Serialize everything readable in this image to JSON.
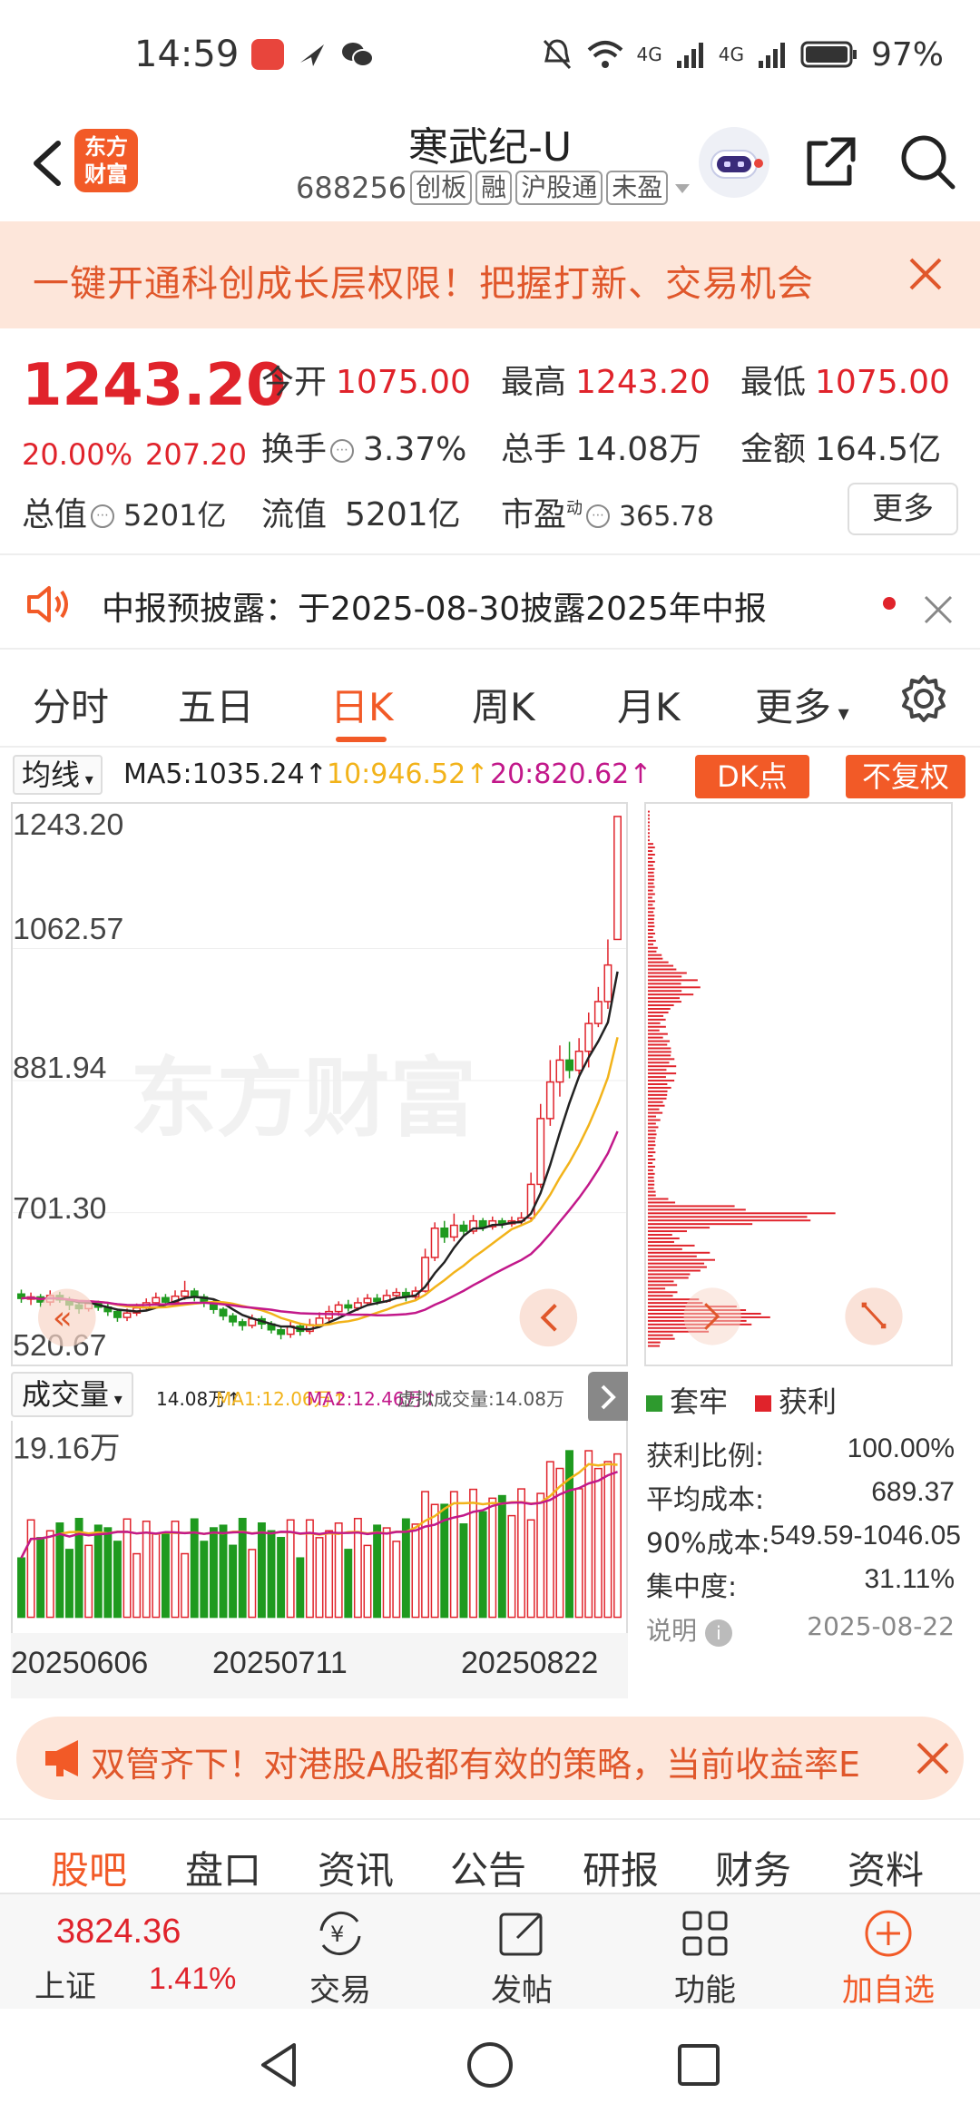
{
  "status": {
    "time": "14:59",
    "network1": "4G",
    "network2": "4G",
    "battery": "97%"
  },
  "header": {
    "logo_text": "东方财富",
    "title": "寒武纪-U",
    "code": "688256",
    "tags": [
      "创板",
      "融",
      "沪股通",
      "未盈"
    ]
  },
  "banner": {
    "text": "一键开通科创成长层权限！把握打新、交易机会"
  },
  "quote": {
    "price": "1243.20",
    "change_pct": "20.00%",
    "change_val": "207.20",
    "open_label": "今开",
    "open": "1075.00",
    "high_label": "最高",
    "high": "1243.20",
    "low_label": "最低",
    "low": "1075.00",
    "turnover_label": "换手",
    "turnover": "3.37%",
    "volume_label": "总手",
    "volume": "14.08万",
    "amount_label": "金额",
    "amount": "164.5亿",
    "mcap_label": "总值",
    "mcap": "5201亿",
    "float_label": "流值",
    "float_cap": "5201亿",
    "pe_label": "市盈",
    "pe_sup": "动",
    "pe": "365.78",
    "more": "更多"
  },
  "notice": {
    "text": "中报预披露：于2025-08-30披露2025年中报"
  },
  "ktabs": [
    "分时",
    "五日",
    "日K",
    "周K",
    "月K",
    "更多"
  ],
  "ma": {
    "select": "均线",
    "ma5": "MA5:1035.24↑",
    "ma10": "10:946.52↑",
    "ma20": "20:820.62↑",
    "btn_dk": "DK点",
    "btn_fq": "不复权",
    "ma5_color": "#222222",
    "ma10_color": "#f2b31a",
    "ma20_color": "#c2188a"
  },
  "kchart": {
    "ylabels": [
      "1243.20",
      "1062.57",
      "881.94",
      "701.30",
      "520.67"
    ],
    "watermark": "东方财富"
  },
  "volume": {
    "select": "成交量",
    "v": "14.08万↑",
    "ma1": "MA1:12.06万↑",
    "ma2": "MA2:12.46万↑",
    "virtual": "虚拟成交量:14.08万",
    "ymax": "19.16万"
  },
  "dates": [
    "20250606",
    "20250711",
    "20250822"
  ],
  "chips": {
    "legend_trapped": "套牢",
    "legend_profit": "获利",
    "rows": [
      {
        "label": "获利比例:",
        "value": "100.00%"
      },
      {
        "label": "平均成本:",
        "value": "689.37"
      },
      {
        "label": "90%成本:",
        "value": "549.59-1046.05"
      },
      {
        "label": "集中度:",
        "value": "31.11%"
      }
    ],
    "note": "说明",
    "date": "2025-08-22"
  },
  "ad": {
    "text": "双管齐下！对港股A股都有效的策略，当前收益率E"
  },
  "section_tabs": [
    "股吧",
    "盘口",
    "资讯",
    "公告",
    "研报",
    "财务",
    "资料"
  ],
  "bottom": {
    "index_value": "3824.36",
    "index_name": "上证",
    "index_pct": "1.41%",
    "trade": "交易",
    "post": "发帖",
    "func": "功能",
    "watch": "加自选"
  },
  "chart_data": {
    "type": "candlestick",
    "price_range": [
      520.67,
      1243.2
    ],
    "ylabels": [
      1243.2,
      1062.57,
      881.94,
      701.3,
      520.67
    ],
    "candles": [
      [
        590,
        584,
        596,
        578
      ],
      [
        583,
        586,
        592,
        575
      ],
      [
        586,
        579,
        590,
        572
      ],
      [
        579,
        588,
        595,
        574
      ],
      [
        588,
        582,
        593,
        578
      ],
      [
        582,
        575,
        586,
        568
      ],
      [
        575,
        570,
        580,
        563
      ],
      [
        570,
        577,
        582,
        566
      ],
      [
        577,
        572,
        581,
        567
      ],
      [
        572,
        566,
        577,
        560
      ],
      [
        566,
        558,
        570,
        552
      ],
      [
        558,
        564,
        570,
        553
      ],
      [
        564,
        571,
        577,
        560
      ],
      [
        571,
        578,
        584,
        568
      ],
      [
        578,
        585,
        592,
        574
      ],
      [
        585,
        579,
        590,
        574
      ],
      [
        579,
        587,
        595,
        575
      ],
      [
        587,
        594,
        608,
        582
      ],
      [
        594,
        586,
        598,
        580
      ],
      [
        586,
        578,
        590,
        572
      ],
      [
        578,
        569,
        582,
        563
      ],
      [
        569,
        560,
        572,
        554
      ],
      [
        560,
        552,
        564,
        546
      ],
      [
        552,
        547,
        556,
        540
      ],
      [
        547,
        556,
        562,
        543
      ],
      [
        556,
        549,
        560,
        542
      ],
      [
        549,
        541,
        553,
        536
      ],
      [
        541,
        535,
        546,
        528
      ],
      [
        535,
        546,
        552,
        530
      ],
      [
        546,
        539,
        550,
        533
      ],
      [
        539,
        548,
        556,
        535
      ],
      [
        548,
        557,
        565,
        545
      ],
      [
        557,
        566,
        574,
        552
      ],
      [
        566,
        575,
        580,
        560
      ],
      [
        575,
        571,
        582,
        566
      ],
      [
        571,
        578,
        585,
        567
      ],
      [
        578,
        584,
        590,
        574
      ],
      [
        584,
        580,
        590,
        575
      ],
      [
        580,
        588,
        596,
        578
      ],
      [
        588,
        592,
        598,
        584
      ],
      [
        592,
        586,
        598,
        580
      ],
      [
        586,
        594,
        600,
        582
      ],
      [
        594,
        640,
        652,
        592
      ],
      [
        640,
        680,
        688,
        635
      ],
      [
        680,
        668,
        690,
        660
      ],
      [
        668,
        684,
        700,
        662
      ],
      [
        684,
        676,
        690,
        670
      ],
      [
        676,
        690,
        698,
        672
      ],
      [
        690,
        682,
        694,
        676
      ],
      [
        682,
        690,
        696,
        678
      ],
      [
        690,
        686,
        694,
        680
      ],
      [
        686,
        690,
        696,
        682
      ],
      [
        690,
        694,
        702,
        684
      ],
      [
        694,
        740,
        756,
        690
      ],
      [
        740,
        830,
        850,
        735
      ],
      [
        830,
        880,
        910,
        820
      ],
      [
        880,
        910,
        930,
        860
      ],
      [
        910,
        896,
        935,
        885
      ],
      [
        896,
        922,
        940,
        890
      ],
      [
        922,
        960,
        975,
        900
      ],
      [
        960,
        990,
        1010,
        955
      ],
      [
        990,
        1040,
        1075,
        980
      ],
      [
        1075,
        1243.2,
        1243.2,
        1075
      ]
    ],
    "vol_max": 19.16
  }
}
